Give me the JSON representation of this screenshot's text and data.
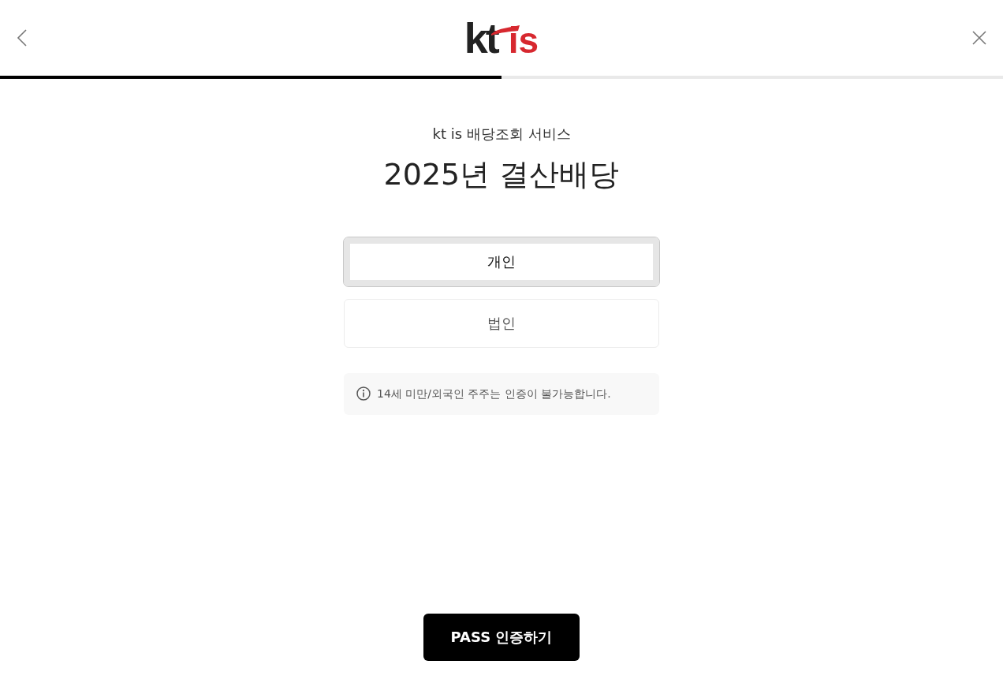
{
  "header": {
    "logo": {
      "brand": "kt",
      "suffix": "is"
    }
  },
  "progress": {
    "level": 0.5
  },
  "subtitle": "kt is 배당조회 서비스",
  "title": "2025년 결산배당",
  "options": [
    {
      "label": "개인",
      "selected": true
    },
    {
      "label": "법인",
      "selected": false
    }
  ],
  "notice": "14세 미만/외국인 주주는 인증이 불가능합니다.",
  "submit": "PASS 인증하기"
}
